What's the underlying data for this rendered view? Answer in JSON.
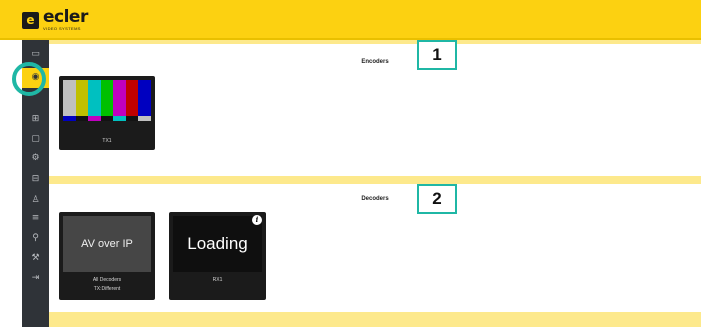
{
  "brand": {
    "logo_mark": "e",
    "name": "ecler",
    "tagline": "VIDEO SYSTEMS"
  },
  "sidebar": {
    "items": [
      {
        "icon": "dashboard-icon",
        "glyph": "▭",
        "active": false
      },
      {
        "icon": "target-icon",
        "glyph": "◉",
        "active": true
      },
      {
        "icon": "matrix-icon",
        "glyph": "⊞",
        "active": false
      },
      {
        "icon": "display-icon",
        "glyph": "▢",
        "active": false
      },
      {
        "icon": "settings-icon",
        "glyph": "⚙",
        "active": false
      },
      {
        "icon": "grid-icon",
        "glyph": "⊟",
        "active": false
      },
      {
        "icon": "user-icon",
        "glyph": "♙",
        "active": false
      },
      {
        "icon": "sliders-icon",
        "glyph": "≡",
        "active": false
      },
      {
        "icon": "network-icon",
        "glyph": "⚲",
        "active": false
      },
      {
        "icon": "wrench-icon",
        "glyph": "⚒",
        "active": false
      },
      {
        "icon": "logout-icon",
        "glyph": "⇥",
        "active": false
      }
    ]
  },
  "encoders": {
    "title": "Encoders",
    "callout": "1",
    "devices": [
      {
        "name": "TX1"
      }
    ]
  },
  "decoders": {
    "title": "Decoders",
    "callout": "2",
    "devices": [
      {
        "screen_text": "AV over IP",
        "name": "All Decoders",
        "sub": "TX:Different"
      },
      {
        "screen_text": "Loading",
        "name": "RX1",
        "info": "i"
      }
    ]
  },
  "colors": {
    "brand_yellow": "#fcd111",
    "sidebar_dark": "#2f3338",
    "highlight_teal": "#1fb7a5",
    "color_bars_top": [
      "#c0c0c0",
      "#c0c000",
      "#00c0c0",
      "#00c000",
      "#c000c0",
      "#c00000",
      "#0000c0"
    ],
    "color_bars_mid": [
      "#0000c0",
      "#131313",
      "#c000c0",
      "#131313",
      "#00c0c0",
      "#131313",
      "#c0c0c0"
    ],
    "color_bars_bot": [
      "#00214c",
      "#ffffff",
      "#32006a",
      "#131313",
      "#090909",
      "#131313",
      "#1d1d1d",
      "#131313"
    ]
  }
}
